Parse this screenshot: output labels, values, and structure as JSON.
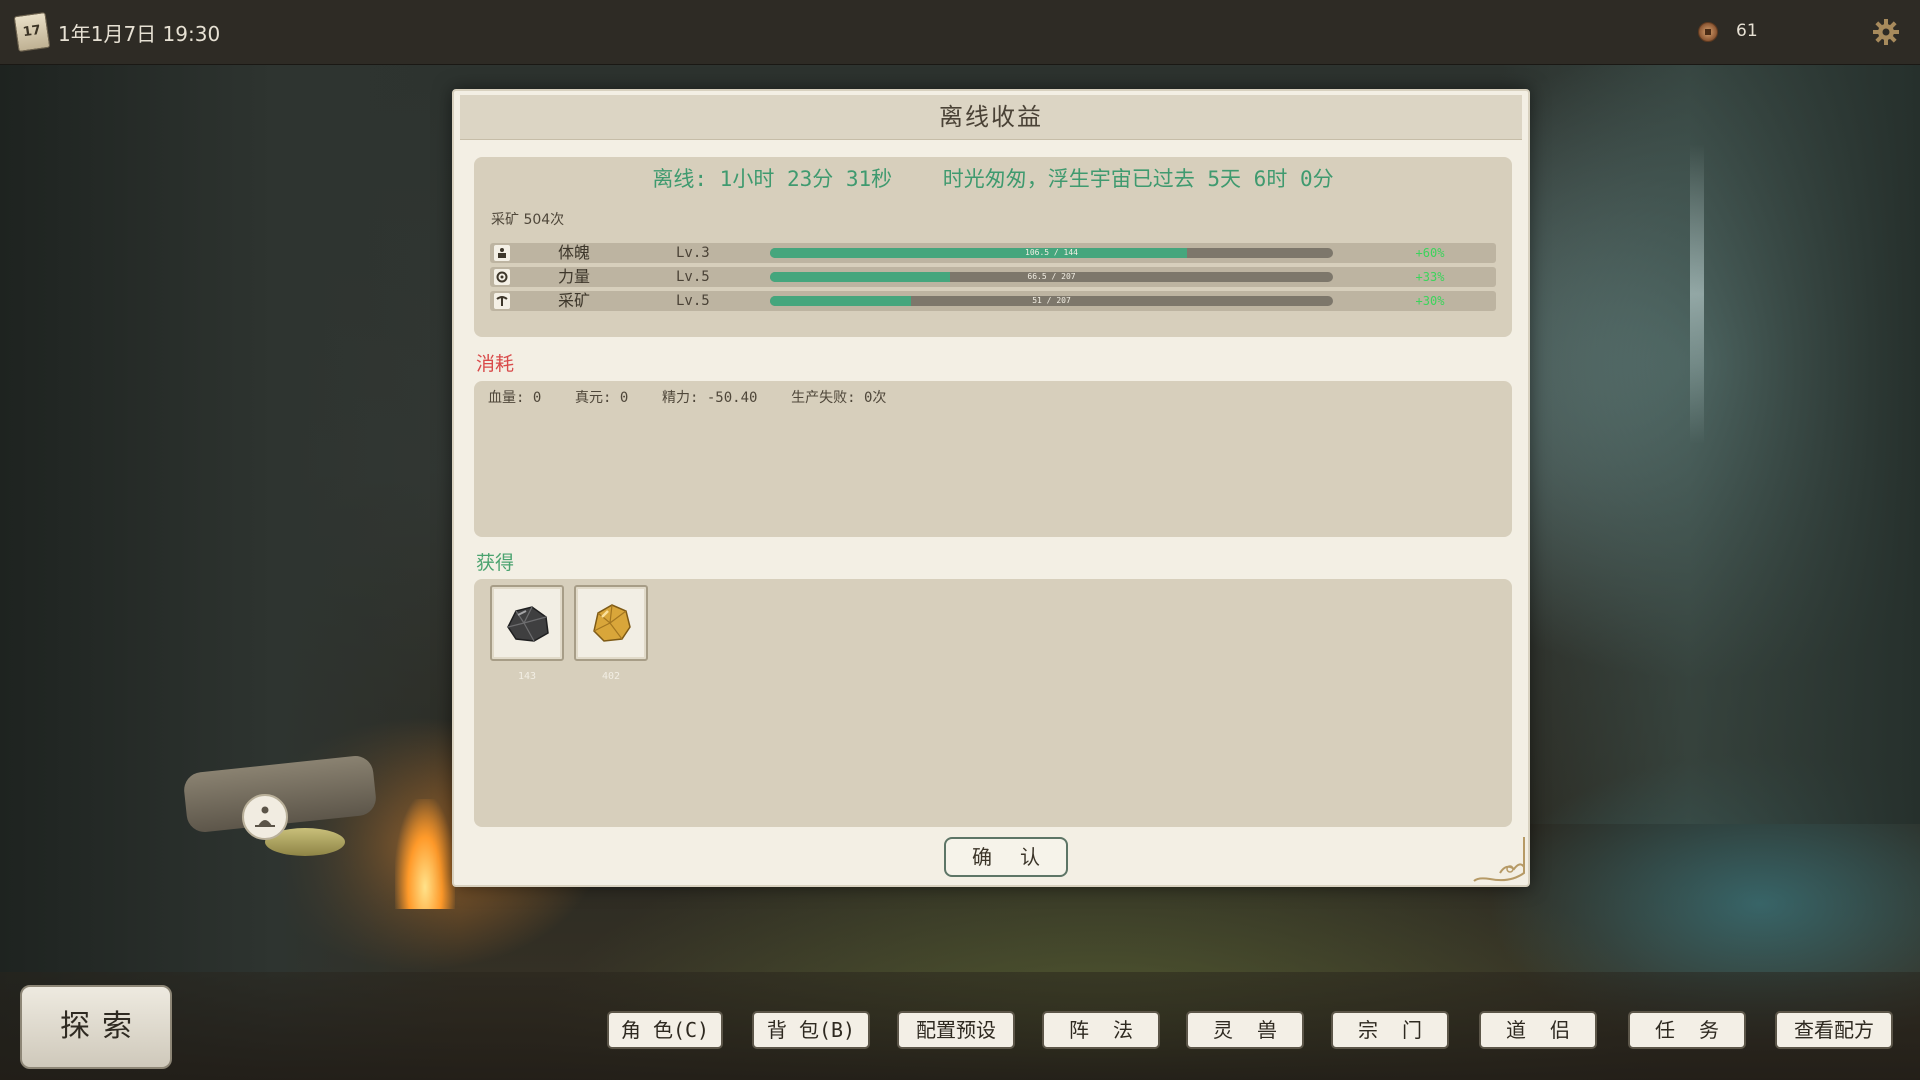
{
  "topbar": {
    "calendar_day": "17",
    "datetime": "1年1月7日  19:30",
    "coin_count": "61"
  },
  "dialog": {
    "title": "离线收益",
    "offline_summary": "离线: 1小时 23分 31秒    时光匆匆，浮生宇宙已过去 5天 6时 0分",
    "activity": "采矿 504次",
    "skills": [
      {
        "name": "体魄",
        "level": "Lv.3",
        "progress_text": "106.5 / 144",
        "progress_fraction": 0.74,
        "gain": "+60%"
      },
      {
        "name": "力量",
        "level": "Lv.5",
        "progress_text": "66.5 / 207",
        "progress_fraction": 0.32,
        "gain": "+33%"
      },
      {
        "name": "采矿",
        "level": "Lv.5",
        "progress_text": "51 / 207",
        "progress_fraction": 0.25,
        "gain": "+30%"
      }
    ],
    "consume_label": "消耗",
    "consume_text": "血量: 0    真元: 0    精力: -50.40    生产失败: 0次",
    "obtain_label": "获得",
    "items": [
      {
        "icon": "iron-ore-icon",
        "count": "143"
      },
      {
        "icon": "gold-ore-icon",
        "count": "402"
      }
    ],
    "confirm_label": "确 认"
  },
  "bottom": {
    "explore_label": "探索",
    "nav": [
      {
        "key": "character",
        "label": "角 色(C)"
      },
      {
        "key": "bag",
        "label": "背 包(B)"
      },
      {
        "key": "preset",
        "label": "配置预设"
      },
      {
        "key": "formation",
        "label": "阵  法"
      },
      {
        "key": "spirit-beast",
        "label": "灵  兽"
      },
      {
        "key": "sect",
        "label": "宗  门"
      },
      {
        "key": "companion",
        "label": "道  侣"
      },
      {
        "key": "quest",
        "label": "任  务"
      },
      {
        "key": "recipes",
        "label": "查看配方"
      }
    ]
  },
  "colors": {
    "accent_green": "#45a67d",
    "consume_red": "#d94a4a",
    "obtain_green": "#4aa36f",
    "gain_green": "#3cd45c"
  }
}
